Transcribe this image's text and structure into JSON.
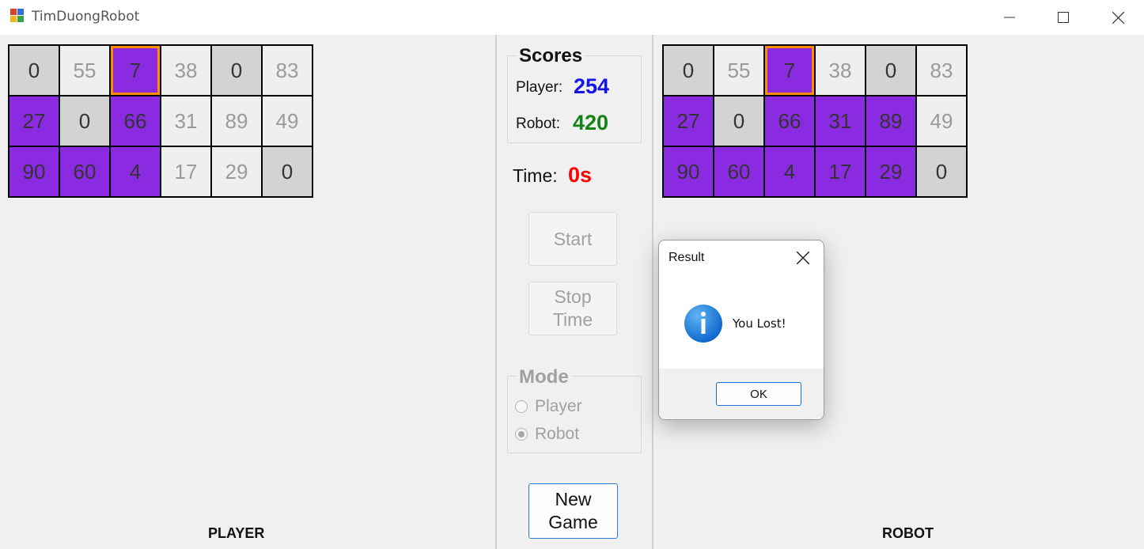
{
  "window": {
    "title": "TimDuongRobot",
    "controls": {
      "minimize": "minimize-icon",
      "maximize": "maximize-icon",
      "close": "close-icon"
    }
  },
  "colors": {
    "path": "#8a2be2",
    "current_border": "#ff8c00",
    "zero_cell": "#d3d3d3",
    "empty_cell": "#efefef",
    "player_score": "#1414e6",
    "robot_score": "#168216",
    "time": "#ff0000"
  },
  "player_board": {
    "label": "PLAYER",
    "rows": [
      [
        {
          "v": "0",
          "s": "zero"
        },
        {
          "v": "55",
          "s": "empty"
        },
        {
          "v": "7",
          "s": "current"
        },
        {
          "v": "38",
          "s": "empty"
        },
        {
          "v": "0",
          "s": "zero"
        },
        {
          "v": "83",
          "s": "empty"
        }
      ],
      [
        {
          "v": "27",
          "s": "path"
        },
        {
          "v": "0",
          "s": "zero"
        },
        {
          "v": "66",
          "s": "path"
        },
        {
          "v": "31",
          "s": "empty"
        },
        {
          "v": "89",
          "s": "empty"
        },
        {
          "v": "49",
          "s": "empty"
        }
      ],
      [
        {
          "v": "90",
          "s": "path"
        },
        {
          "v": "60",
          "s": "path"
        },
        {
          "v": "4",
          "s": "path"
        },
        {
          "v": "17",
          "s": "empty"
        },
        {
          "v": "29",
          "s": "empty"
        },
        {
          "v": "0",
          "s": "zero"
        }
      ]
    ]
  },
  "robot_board": {
    "label": "ROBOT",
    "rows": [
      [
        {
          "v": "0",
          "s": "zero"
        },
        {
          "v": "55",
          "s": "empty"
        },
        {
          "v": "7",
          "s": "current"
        },
        {
          "v": "38",
          "s": "empty"
        },
        {
          "v": "0",
          "s": "zero"
        },
        {
          "v": "83",
          "s": "empty"
        }
      ],
      [
        {
          "v": "27",
          "s": "path"
        },
        {
          "v": "0",
          "s": "zero"
        },
        {
          "v": "66",
          "s": "path"
        },
        {
          "v": "31",
          "s": "path"
        },
        {
          "v": "89",
          "s": "path"
        },
        {
          "v": "49",
          "s": "empty"
        }
      ],
      [
        {
          "v": "90",
          "s": "path"
        },
        {
          "v": "60",
          "s": "path"
        },
        {
          "v": "4",
          "s": "path"
        },
        {
          "v": "17",
          "s": "path"
        },
        {
          "v": "29",
          "s": "path"
        },
        {
          "v": "0",
          "s": "zero"
        }
      ]
    ]
  },
  "scores": {
    "title": "Scores",
    "player_label": "Player:",
    "player_value": "254",
    "robot_label": "Robot:",
    "robot_value": "420"
  },
  "time": {
    "label": "Time:",
    "value": "0s"
  },
  "buttons": {
    "start": "Start",
    "stop_time": "Stop Time",
    "new_game": "New Game"
  },
  "mode": {
    "title": "Mode",
    "options": [
      {
        "label": "Player",
        "checked": false
      },
      {
        "label": "Robot",
        "checked": true
      }
    ]
  },
  "dialog": {
    "title": "Result",
    "icon": "info-icon",
    "message": "You Lost!",
    "ok_label": "OK"
  }
}
